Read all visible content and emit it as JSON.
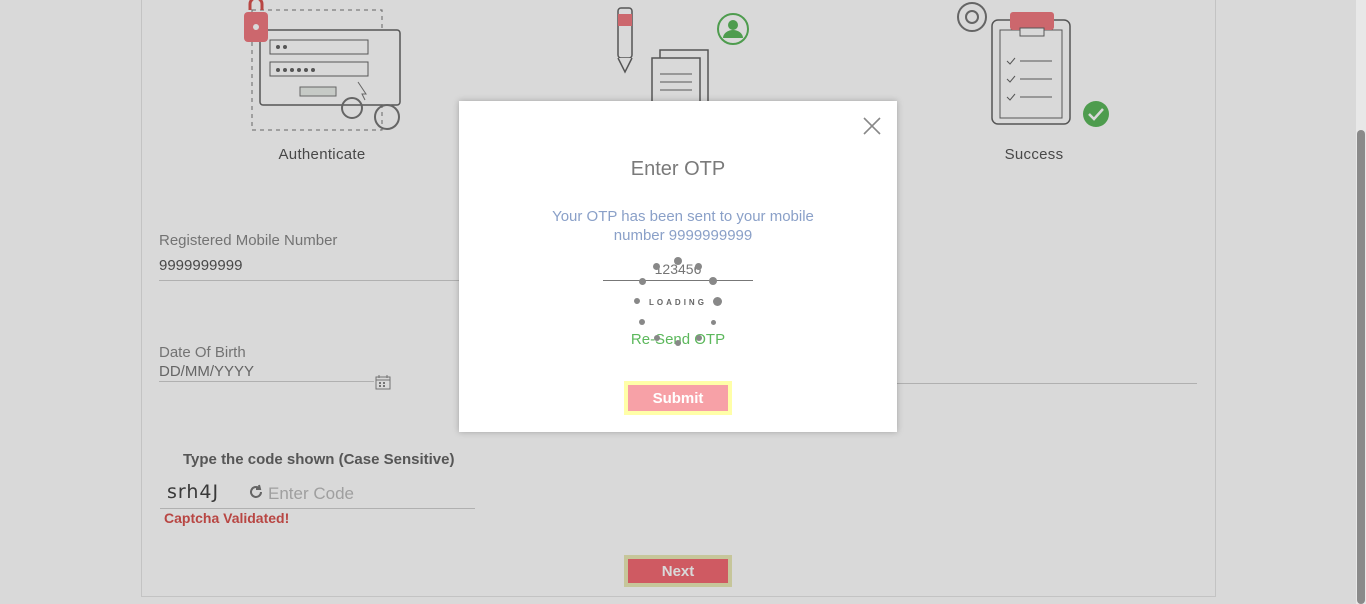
{
  "steps": [
    {
      "label": "Authenticate"
    },
    {
      "label": "Success"
    }
  ],
  "form": {
    "mobile_label": "Registered Mobile Number",
    "mobile_value": "9999999999",
    "dob_label": "Date Of Birth",
    "dob_placeholder": "DD/MM/YYYY",
    "captcha_title": "Type the code shown (Case Sensitive)",
    "captcha_code": "srh4J",
    "captcha_input_placeholder": "Enter Code",
    "captcha_status": "Captcha Validated!",
    "next_label": "Next"
  },
  "modal": {
    "title": "Enter OTP",
    "description": "Your OTP has been sent to your mobile number 9999999999",
    "otp_placeholder": "123456",
    "resend_label": "Re-Send OTP",
    "submit_label": "Submit",
    "loading_text": "LOADING"
  },
  "colors": {
    "accent": "#f46a74",
    "success": "#5cb85c",
    "button_glow": "#ffffa8"
  }
}
